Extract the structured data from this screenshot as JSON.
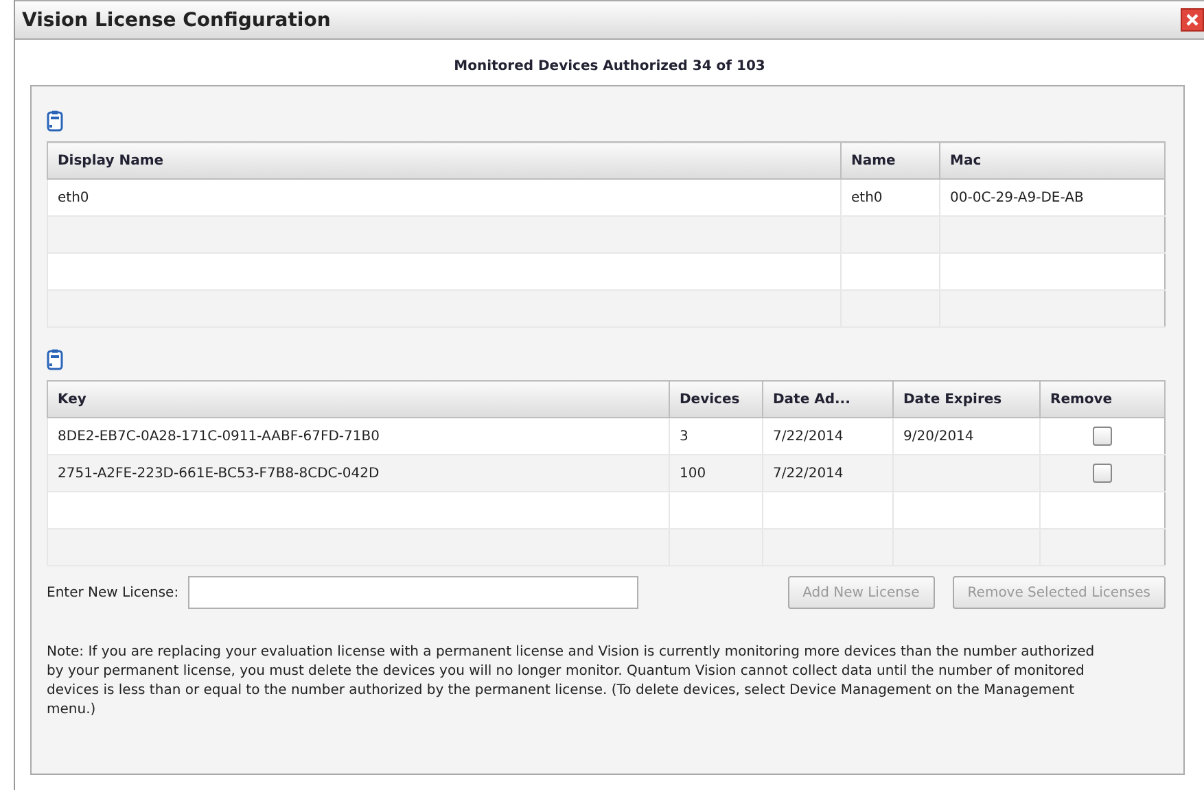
{
  "window": {
    "title": "Vision License Configuration"
  },
  "summary": "Monitored Devices Authorized 34 of 103",
  "devices": {
    "columns": [
      "Display Name",
      "Name",
      "Mac"
    ],
    "rows": [
      {
        "cells": [
          "eth0",
          "eth0",
          "00-0C-29-A9-DE-AB"
        ]
      }
    ]
  },
  "licenses": {
    "columns": [
      "Key",
      "Devices",
      "Date Ad...",
      "Date Expires",
      "Remove"
    ],
    "rows": [
      {
        "key": "8DE2-EB7C-0A28-171C-0911-AABF-67FD-71B0",
        "devices": "3",
        "date_added": "7/22/2014",
        "date_expires": "9/20/2014",
        "checked": false
      },
      {
        "key": "2751-A2FE-223D-661E-BC53-F7B8-8CDC-042D",
        "devices": "100",
        "date_added": "7/22/2014",
        "checked": false
      }
    ]
  },
  "new_license": {
    "label": "Enter New License:"
  },
  "buttons": [
    {
      "label": "Add New License",
      "disabled": true
    },
    {
      "label": "Remove Selected Licenses",
      "disabled": true
    }
  ],
  "note": "Note: If you are replacing your evaluation license with a permanent license and Vision is currently monitoring more devices than the number authorized by your permanent license, you must delete the devices you will no longer monitor. Quantum Vision cannot collect data until the number of monitored devices is less than or equal to the number authorized by the permanent license. (To delete devices, select Device Management on the Management menu.)"
}
